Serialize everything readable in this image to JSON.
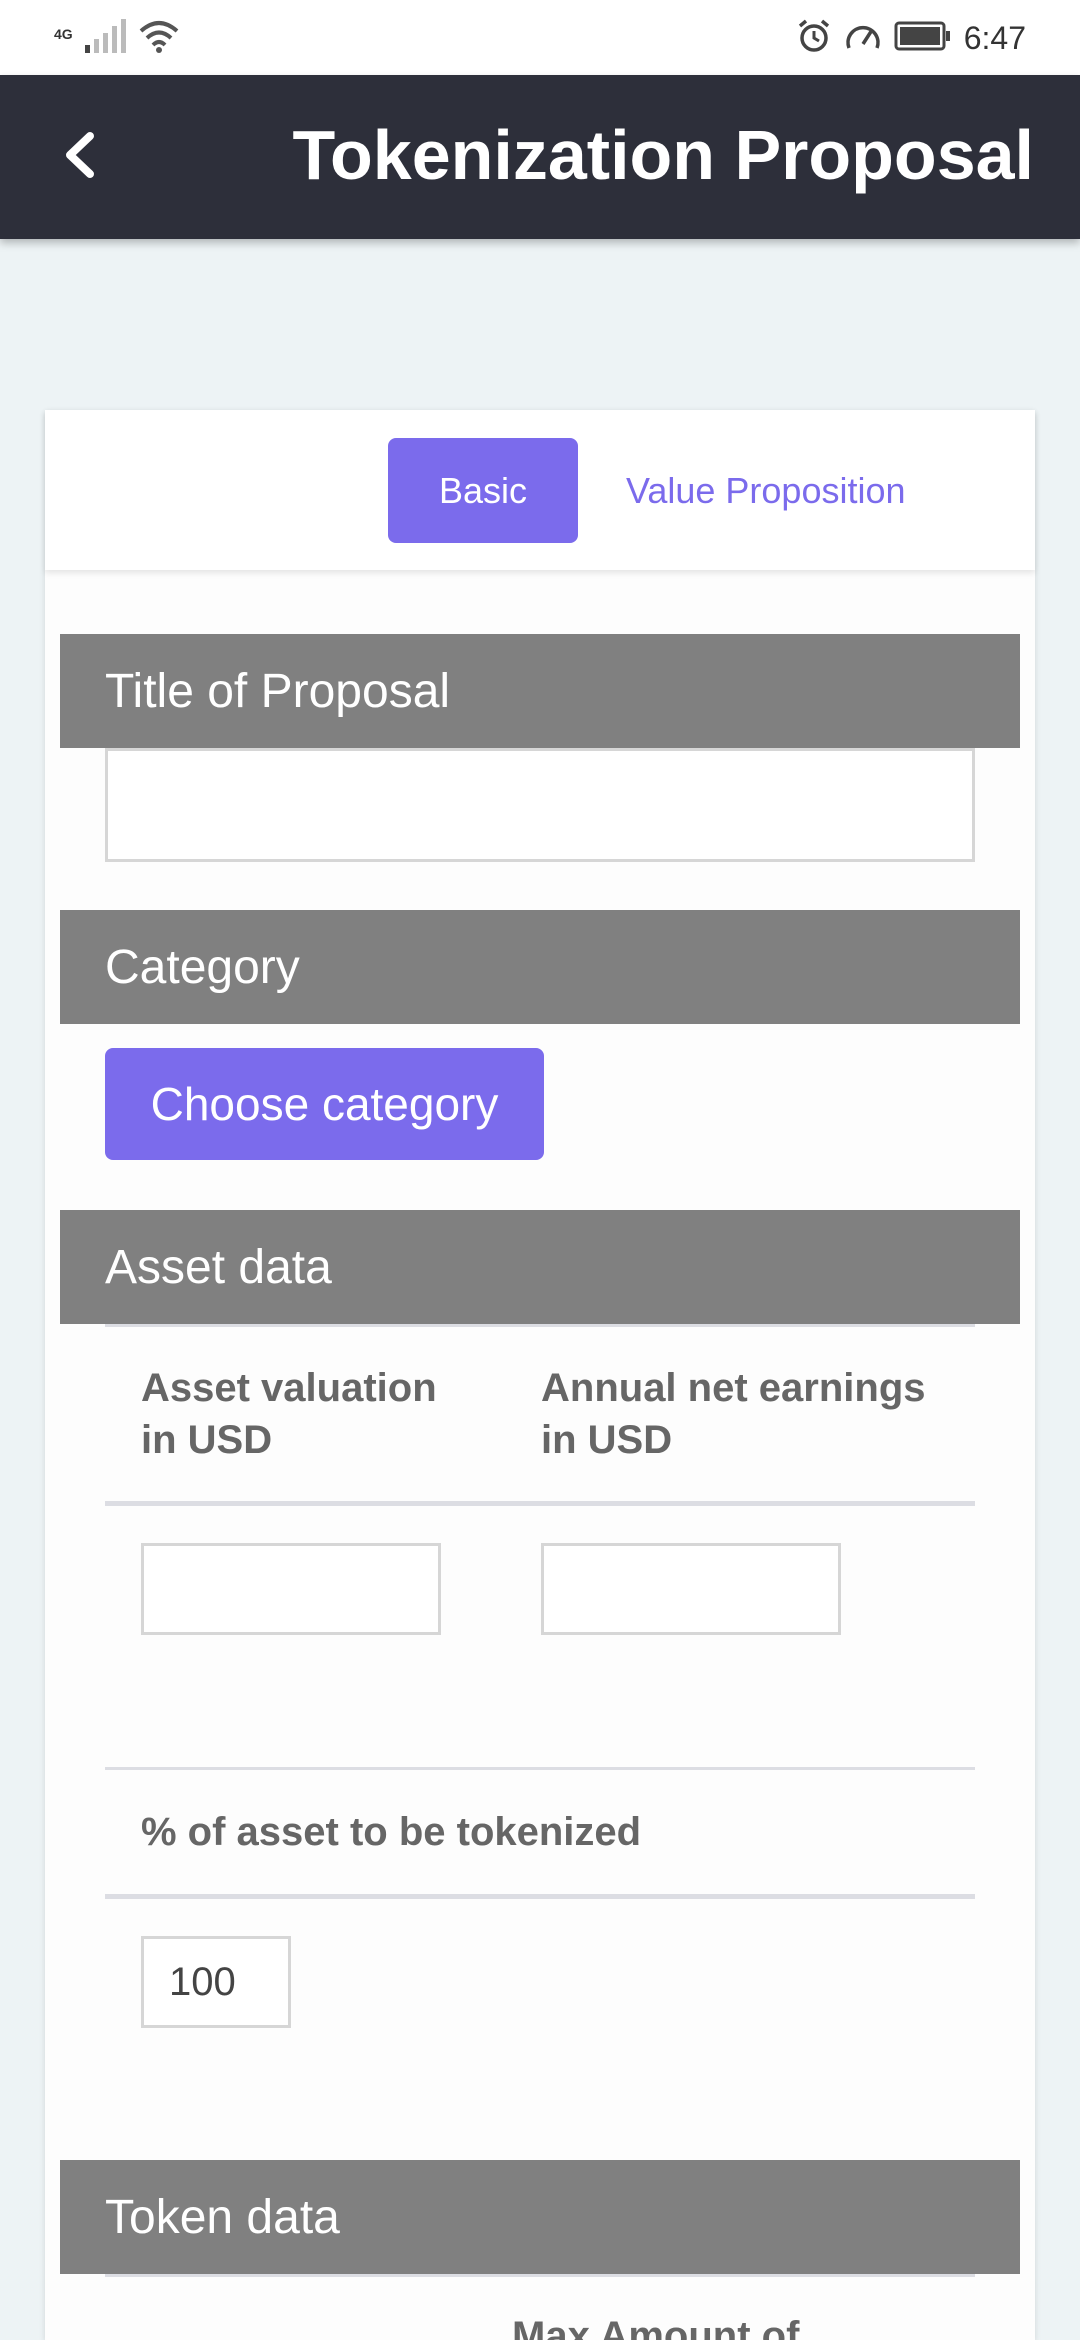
{
  "status_bar": {
    "network": "4G",
    "time": "6:47",
    "icons": [
      "signal-icon",
      "wifi-icon",
      "alarm-icon",
      "speed-icon",
      "battery-icon"
    ]
  },
  "app_bar": {
    "title": "Tokenization Proposal",
    "back_icon": "chevron-left-icon"
  },
  "tabs": {
    "basic": "Basic",
    "value_proposition": "Value Proposition",
    "active": "Basic"
  },
  "sections": {
    "title": {
      "header": "Title of Proposal",
      "value": ""
    },
    "category": {
      "header": "Category",
      "button_label": "Choose category"
    },
    "asset_data": {
      "header": "Asset data",
      "asset_valuation_label_line1": "Asset valuation",
      "asset_valuation_label_line2": "in USD",
      "annual_earnings_label_line1": "Annual net earnings",
      "annual_earnings_label_line2": "in USD",
      "asset_valuation_value": "",
      "annual_earnings_value": "",
      "tokenized_percent_label": "% of asset to be tokenized",
      "tokenized_percent_value": "100"
    },
    "token_data": {
      "header": "Token data",
      "max_amount_label": "Max Amount of"
    }
  },
  "colors": {
    "accent": "#7b6bec",
    "app_bar": "#2d2f3a",
    "section_header": "#808080",
    "background": "#edf3f5"
  }
}
